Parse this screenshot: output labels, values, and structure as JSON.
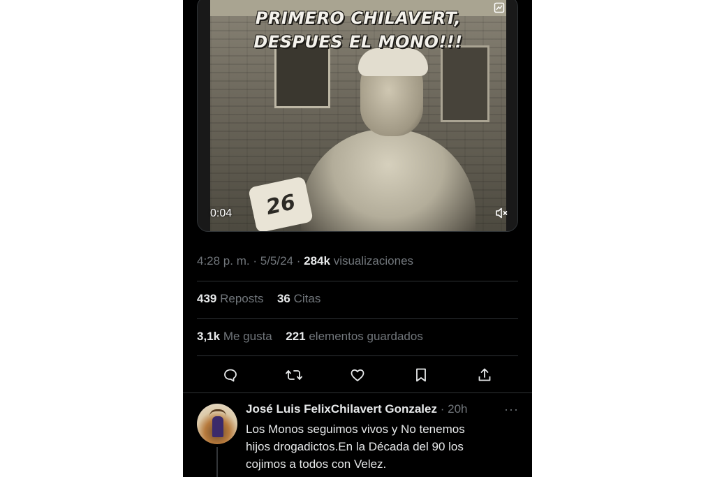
{
  "video": {
    "caption_line1": "PRIMERO CHILAVERT,",
    "caption_line2": "DESPUES EL MONO!!!",
    "mic_label": "26",
    "elapsed": "0:04"
  },
  "post_meta": {
    "time": "4:28 p. m.",
    "date": "5/5/24",
    "views_count": "284k",
    "views_label": "visualizaciones"
  },
  "stats": {
    "reposts_count": "439",
    "reposts_label": "Reposts",
    "quotes_count": "36",
    "quotes_label": "Citas",
    "likes_count": "3,1k",
    "likes_label": "Me gusta",
    "bookmarks_count": "221",
    "bookmarks_label": "elementos guardados"
  },
  "actions": [
    "reply-icon",
    "repost-icon",
    "like-icon",
    "bookmark-icon",
    "share-icon"
  ],
  "reply": {
    "author": "José Luis FelixChilavert Gonzalez",
    "separator": "·",
    "time": "20h",
    "more": "···",
    "text_line1": "Los Monos seguimos vivos y No tenemos",
    "text_line2": "hijos drogadictos.En la Década del 90 los",
    "text_line3": "cojimos a todos con Velez."
  },
  "colors": {
    "background": "#000000",
    "text": "#e7e9ea",
    "muted": "#71767b",
    "divider": "#2f3336"
  }
}
